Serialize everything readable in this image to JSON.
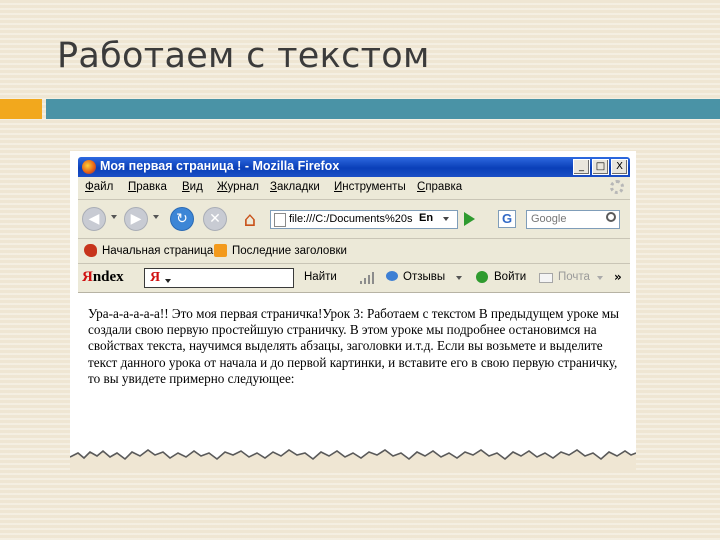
{
  "slide": {
    "title": "Работаем с текстом"
  },
  "browser": {
    "window_title": "Моя первая страница ! - Mozilla Firefox",
    "window_controls": [
      "_",
      "□",
      "X"
    ],
    "menu": [
      "Файл",
      "Правка",
      "Вид",
      "Журнал",
      "Закладки",
      "Инструменты",
      "Справка"
    ],
    "url": "file:///C:/Documents%20s",
    "url_lang": "En",
    "search_engine_icon": "G",
    "search_placeholder": "Google",
    "bookmarks": [
      "Начальная страница",
      "Последние заголовки"
    ],
    "yandex_bar": {
      "logo_prefix": "Я",
      "logo_rest": "ndex",
      "input_logo": "Я",
      "find": "Найти",
      "reviews": "Отзывы",
      "login": "Войти",
      "mail": "Почта",
      "more": "»"
    },
    "page_text": "Ура-а-а-а-а-а!! Это моя первая страничка!Урок 3: Работаем с текстом В предыдущем уроке мы создали свою первую простейшую страничку. В этом уроке мы подробнее остановимся на свойствах текста, научимся выделять абзацы, заголовки и.т.д. Если вы возьмете и выделите текст данного урока от начала и до первой картинки, и вставите его в свою первую страничку, то вы увидете примерно следующее:"
  },
  "colors": {
    "accent_orange": "#f2a81d",
    "accent_blue": "#4a93a6",
    "titlebar_blue": "#0a3fb8"
  }
}
